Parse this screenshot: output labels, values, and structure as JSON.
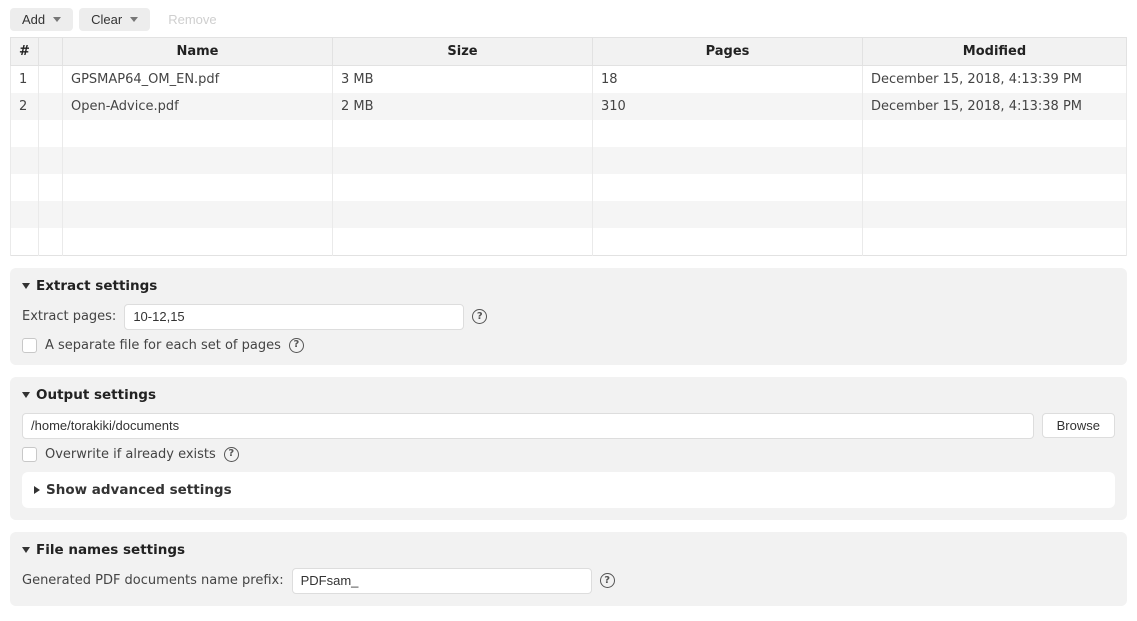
{
  "toolbar": {
    "add": "Add",
    "clear": "Clear",
    "remove": "Remove"
  },
  "table": {
    "headers": {
      "hash": "#",
      "lock": "",
      "name": "Name",
      "size": "Size",
      "pages": "Pages",
      "modified": "Modified"
    },
    "rows": [
      {
        "idx": "1",
        "name": "GPSMAP64_OM_EN.pdf",
        "size": "3 MB",
        "pages": "18",
        "modified": "December 15, 2018, 4:13:39 PM"
      },
      {
        "idx": "2",
        "name": "Open-Advice.pdf",
        "size": "2 MB",
        "pages": "310",
        "modified": "December 15, 2018, 4:13:38 PM"
      }
    ],
    "empty_rows": 5
  },
  "extract": {
    "title": "Extract settings",
    "pages_label": "Extract pages:",
    "pages_value": "10-12,15",
    "separate_file_label": "A separate file for each set of pages"
  },
  "output": {
    "title": "Output settings",
    "path": "/home/torakiki/documents",
    "browse": "Browse",
    "overwrite_label": "Overwrite if already exists",
    "advanced_title": "Show advanced settings"
  },
  "filenames": {
    "title": "File names settings",
    "prefix_label": "Generated PDF documents name prefix:",
    "prefix_value": "PDFsam_"
  }
}
